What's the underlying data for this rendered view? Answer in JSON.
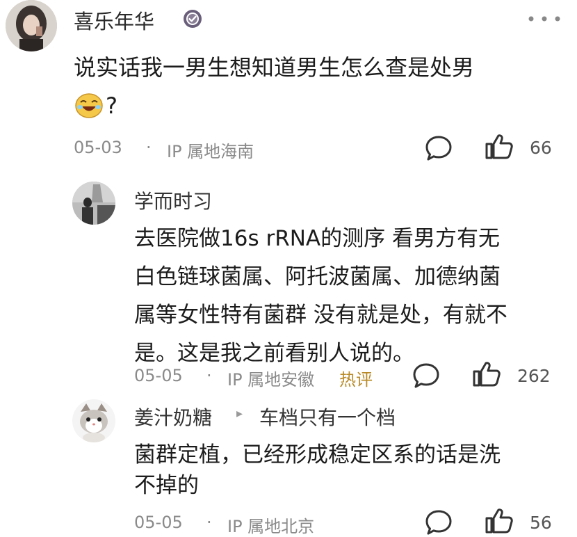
{
  "main_comment": {
    "username": "喜乐年华",
    "badge": "verified-badge-icon",
    "more": "...",
    "text": "说实话我一男生想知道男生怎么查是处男",
    "emoji": "laughing-emoji",
    "text_suffix": "?",
    "date": "05-03",
    "separator": "·",
    "ip": "IP 属地海南",
    "likes": "66"
  },
  "reply_1": {
    "username": "学而时习",
    "text_lines": [
      "去医院做16s rRNA的测序 看男方有无",
      "白色链球菌属、阿托波菌属、加德纳菌",
      "属等女性特有菌群 没有就是处，有就不",
      "是。这是我之前看别人说的。"
    ],
    "date": "05-05",
    "separator": "·",
    "ip": "IP 属地安徽",
    "tag": "热评",
    "likes": "262"
  },
  "reply_2": {
    "username": "姜汁奶糖",
    "reply_arrow": "▸",
    "reply_to": "车档只有一个档",
    "text_lines": [
      "菌群定植，已经形成稳定区系的话是洗",
      "不掉的"
    ],
    "date": "05-05",
    "separator": "·",
    "ip": "IP 属地北京",
    "likes": "56"
  },
  "colors": {
    "text": "#1c1c1c",
    "meta": "#8a8a8a",
    "hot_tag": "#b98b28",
    "badge": "#6a5f7a"
  }
}
